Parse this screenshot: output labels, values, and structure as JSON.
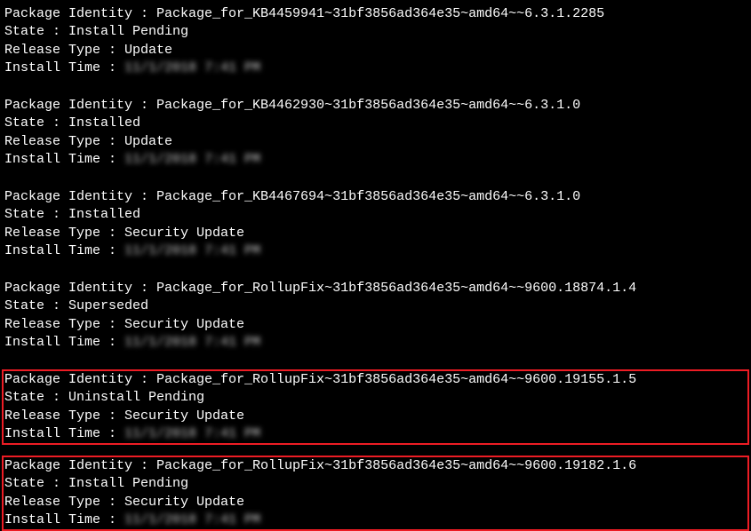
{
  "labels": {
    "package_identity": "Package Identity : ",
    "state": "State : ",
    "release_type": "Release Type : ",
    "install_time": "Install Time : "
  },
  "blurred_time_placeholder": "11/1/2018 7:41 PM",
  "packages": [
    {
      "identity": "Package_for_KB4459941~31bf3856ad364e35~amd64~~6.3.1.2285",
      "state": "Install Pending",
      "release_type": "Update",
      "highlighted": false
    },
    {
      "identity": "Package_for_KB4462930~31bf3856ad364e35~amd64~~6.3.1.0",
      "state": "Installed",
      "release_type": "Update",
      "highlighted": false
    },
    {
      "identity": "Package_for_KB4467694~31bf3856ad364e35~amd64~~6.3.1.0",
      "state": "Installed",
      "release_type": "Security Update",
      "highlighted": false
    },
    {
      "identity": "Package_for_RollupFix~31bf3856ad364e35~amd64~~9600.18874.1.4",
      "state": "Superseded",
      "release_type": "Security Update",
      "highlighted": false
    },
    {
      "identity": "Package_for_RollupFix~31bf3856ad364e35~amd64~~9600.19155.1.5",
      "state": "Uninstall Pending",
      "release_type": "Security Update",
      "highlighted": true
    },
    {
      "identity": "Package_for_RollupFix~31bf3856ad364e35~amd64~~9600.19182.1.6",
      "state": "Install Pending",
      "release_type": "Security Update",
      "highlighted": true
    }
  ]
}
